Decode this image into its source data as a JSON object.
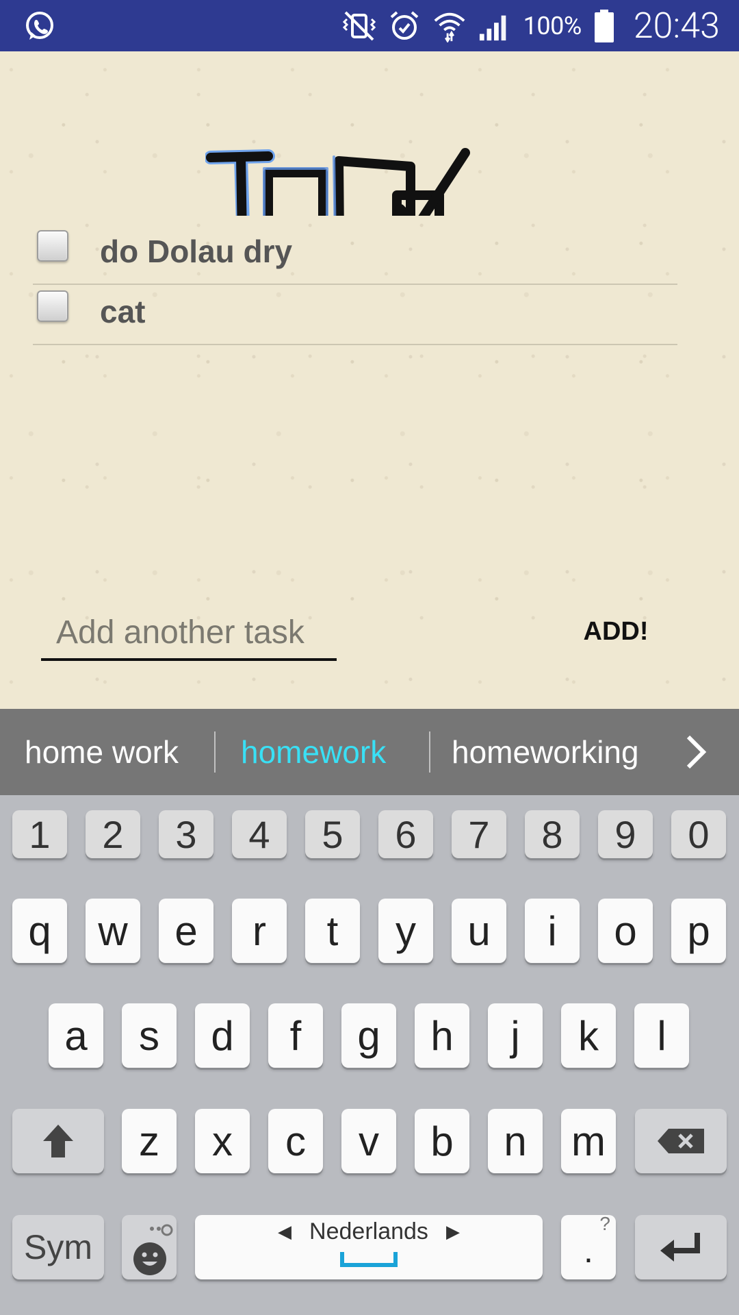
{
  "status_bar": {
    "battery_percent": "100%",
    "time": "20:43",
    "icons": [
      "whatsapp-icon",
      "vibrate-mute-icon",
      "alarm-icon",
      "wifi-icon",
      "signal-icon",
      "battery-icon"
    ]
  },
  "app": {
    "title_image_alt": "TO DO",
    "tasks": [
      {
        "label": "do Dolau dry",
        "checked": false
      },
      {
        "label": "cat",
        "checked": false
      }
    ],
    "input": {
      "placeholder": "Add another task",
      "value": ""
    },
    "add_button": "ADD!"
  },
  "suggestions": [
    "home work",
    "homework",
    "homeworking"
  ],
  "suggestion_highlight_color": "#39e0f5",
  "keyboard": {
    "number_row": [
      "1",
      "2",
      "3",
      "4",
      "5",
      "6",
      "7",
      "8",
      "9",
      "0"
    ],
    "row1": [
      "q",
      "w",
      "e",
      "r",
      "t",
      "y",
      "u",
      "i",
      "o",
      "p"
    ],
    "row2": [
      "a",
      "s",
      "d",
      "f",
      "g",
      "h",
      "j",
      "k",
      "l"
    ],
    "row3": [
      "z",
      "x",
      "c",
      "v",
      "b",
      "n",
      "m"
    ],
    "sym_label": "Sym",
    "language": "Nederlands",
    "period": ".",
    "period_alt": "?"
  }
}
